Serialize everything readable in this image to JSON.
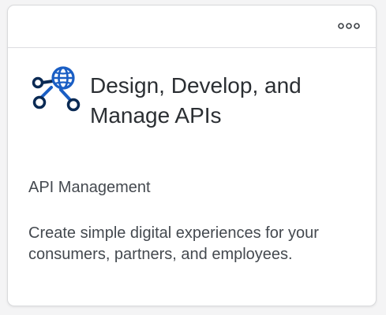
{
  "card": {
    "title": "Design, Develop, and Manage APIs",
    "subtitle": "API Management",
    "description": "Create simple digital experiences for your consumers, partners, and employees.",
    "more_icon": "more-options-icon",
    "main_icon": "api-network-globe-icon"
  },
  "colors": {
    "icon_blue": "#1a5ec4",
    "icon_dark": "#0a2a54",
    "text": "#2b2f33",
    "secondary_text": "#44494f",
    "border": "#d9dadc"
  }
}
